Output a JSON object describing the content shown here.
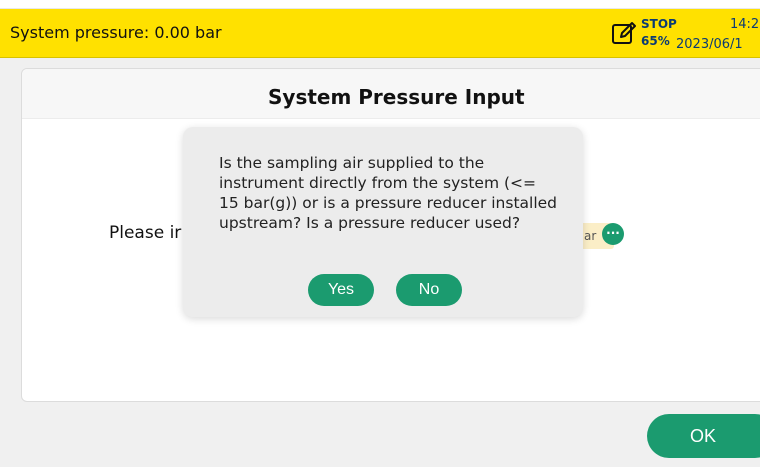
{
  "status": {
    "text": "System pressure: 0.00 bar",
    "stop_label": "STOP",
    "stop_percent": "65%",
    "time": "14:2",
    "date": "2023/06/1",
    "bar_color": "#ffe100"
  },
  "page": {
    "title": "System Pressure Input",
    "prompt": "Please ir",
    "unit": "ar",
    "more_icon": "ellipsis-icon"
  },
  "dialog": {
    "message": "Is the sampling air supplied to the instrument directly from the system (<= 15 bar(g)) or is a pressure reducer installed upstream? Is a pressure reducer used?",
    "yes_label": "Yes",
    "no_label": "No"
  },
  "footer": {
    "ok_label": "OK"
  },
  "colors": {
    "accent": "#1b9b6f",
    "status_text": "#0b3b73"
  }
}
